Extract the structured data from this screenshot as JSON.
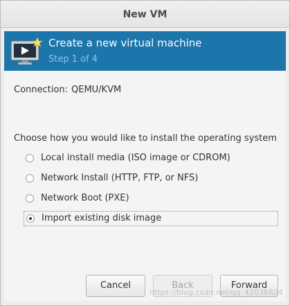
{
  "window": {
    "title": "New VM"
  },
  "header": {
    "title": "Create a new virtual machine",
    "step": "Step 1 of 4",
    "icon": "vm-monitor-icon"
  },
  "connection": {
    "label": "Connection:",
    "value": "QEMU/KVM"
  },
  "install": {
    "prompt": "Choose how you would like to install the operating system",
    "options": [
      {
        "label": "Local install media (ISO image or CDROM)",
        "selected": false
      },
      {
        "label": "Network Install (HTTP, FTP, or NFS)",
        "selected": false
      },
      {
        "label": "Network Boot (PXE)",
        "selected": false
      },
      {
        "label": "Import existing disk image",
        "selected": true
      }
    ]
  },
  "buttons": {
    "cancel": "Cancel",
    "back": "Back",
    "forward": "Forward"
  },
  "watermark": "https://blog.csdn.net/qq_42036824",
  "colors": {
    "header_bg": "#1c75ab",
    "header_step": "#8cc5ea"
  }
}
